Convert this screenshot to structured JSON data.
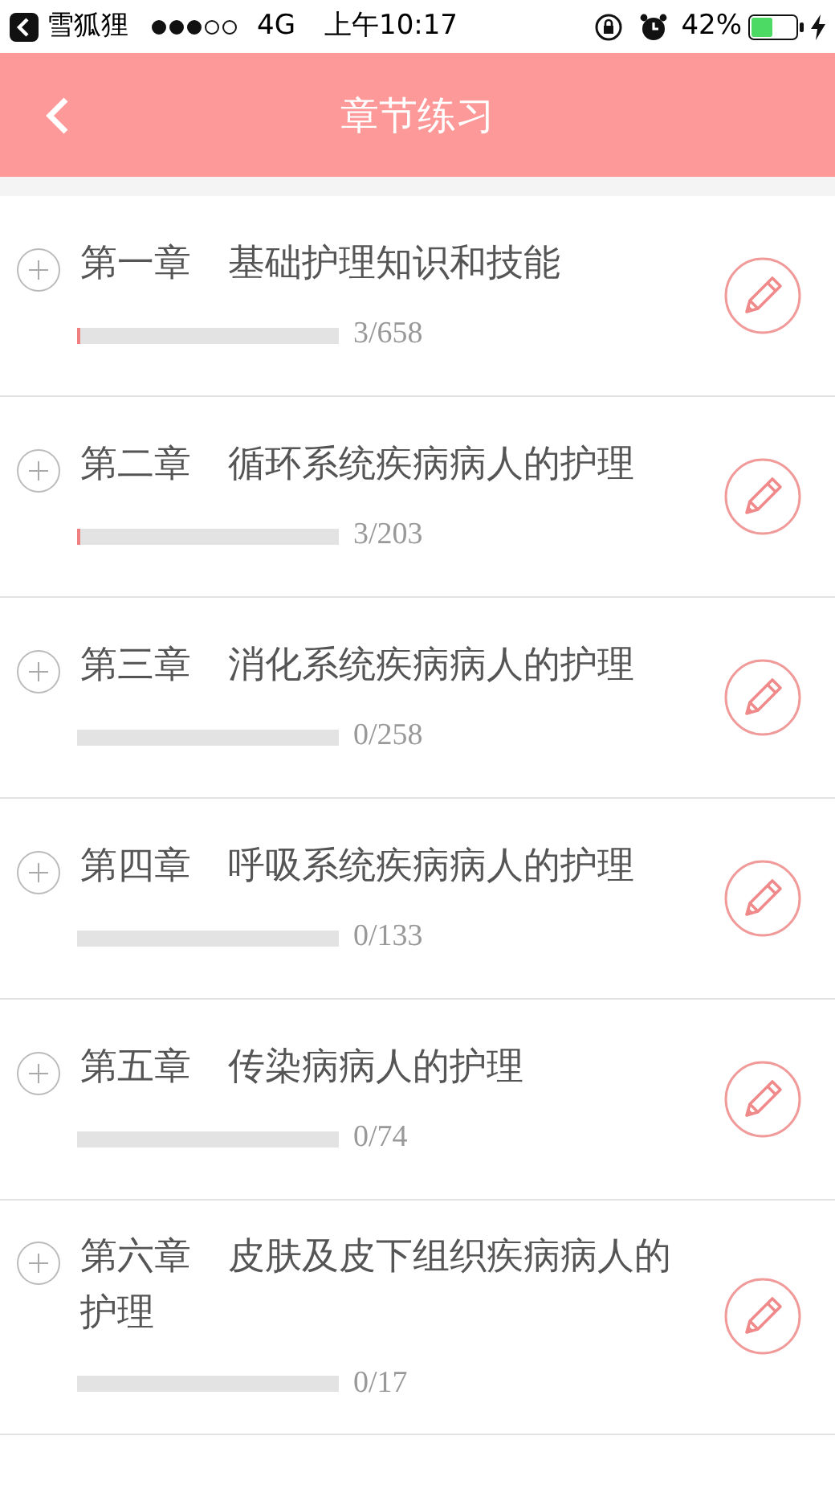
{
  "status_bar": {
    "back_app": "雪狐狸",
    "network": "4G",
    "time": "上午10:17",
    "battery": "42%"
  },
  "header": {
    "title": "章节练习"
  },
  "chapters": [
    {
      "title": "第一章　基础护理知识和技能",
      "count": "3/658",
      "level": 0.005
    },
    {
      "title": "第二章　循环系统疾病病人的护理",
      "count": "3/203",
      "level": 0.015
    },
    {
      "title": "第三章　消化系统疾病病人的护理",
      "count": "0/258"
    },
    {
      "title": "第四章　呼吸系统疾病病人的护理",
      "count": "0/133"
    },
    {
      "title": "第五章　传染病病人的护理",
      "count": "0/74"
    },
    {
      "title": "第六章　皮肤及皮下组织疾病病人的护理",
      "count": "0/17"
    }
  ]
}
